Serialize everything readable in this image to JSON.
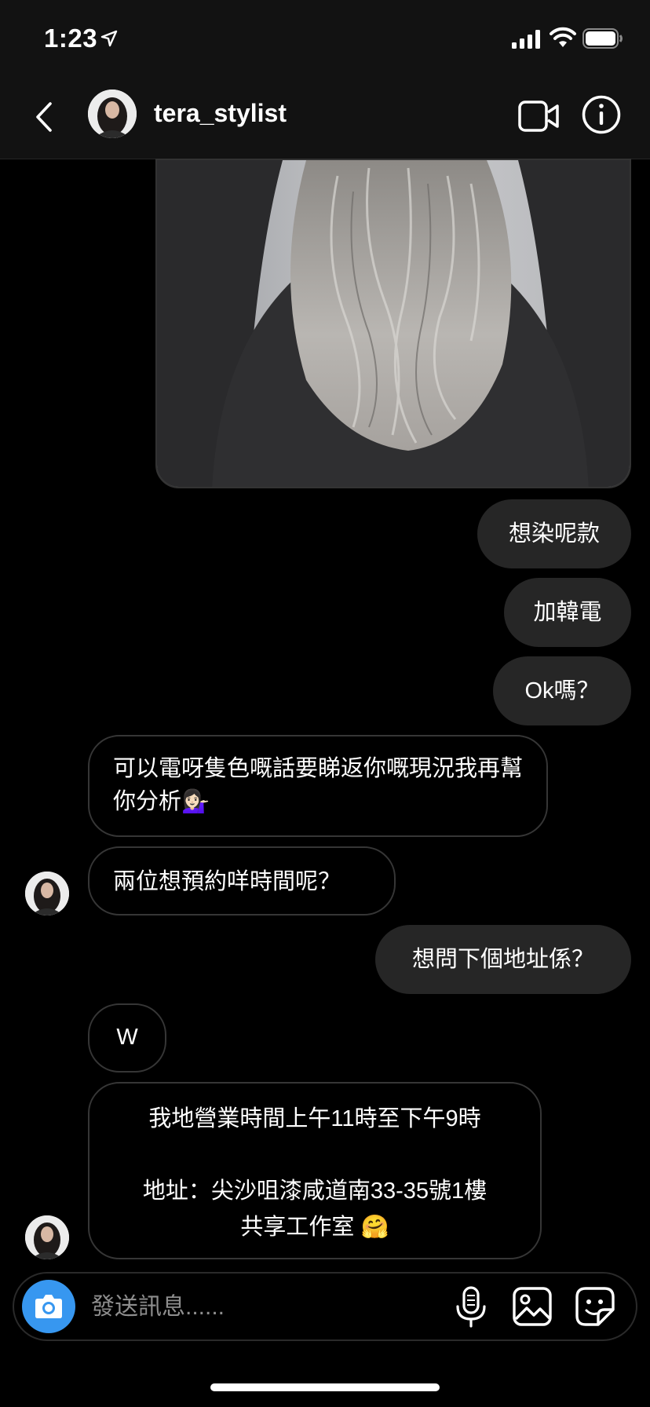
{
  "status_bar": {
    "time": "1:23"
  },
  "header": {
    "username": "tera_stylist"
  },
  "messages": [
    {
      "side": "sent",
      "text": "想染呢款"
    },
    {
      "side": "sent",
      "text": "加韓電"
    },
    {
      "side": "sent",
      "text": "Ok嗎？"
    },
    {
      "side": "received",
      "text": "可以電呀隻色嘅話要睇返你嘅現況我再幫你分析💁🏻‍♀️"
    },
    {
      "side": "received",
      "text": "兩位想預約咩時間呢？"
    },
    {
      "side": "sent",
      "text": "想問下個地址係？"
    },
    {
      "side": "received",
      "text": "W"
    },
    {
      "side": "received",
      "text": "我地營業時間上午11時至下午9時\n\n地址：尖沙咀漆咸道南33-35號1樓\n共享工作室 🤗"
    }
  ],
  "composer": {
    "placeholder": "發送訊息......"
  },
  "icons": [
    "location-arrow-icon",
    "signal-icon",
    "wifi-icon",
    "battery-icon",
    "back-icon",
    "video-call-icon",
    "info-icon",
    "camera-icon",
    "microphone-icon",
    "gallery-icon",
    "sticker-icon"
  ],
  "colors": {
    "accent": "#3797f0",
    "sent_bubble": "#262626",
    "background": "#000000"
  }
}
